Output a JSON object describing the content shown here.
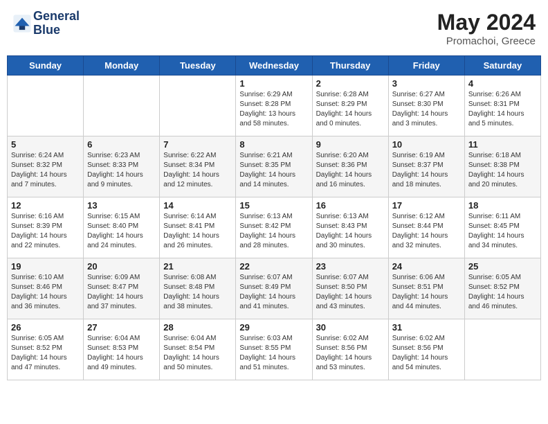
{
  "header": {
    "logo_line1": "General",
    "logo_line2": "Blue",
    "month_year": "May 2024",
    "location": "Promachoi, Greece"
  },
  "weekdays": [
    "Sunday",
    "Monday",
    "Tuesday",
    "Wednesday",
    "Thursday",
    "Friday",
    "Saturday"
  ],
  "weeks": [
    [
      {
        "day": "",
        "info": ""
      },
      {
        "day": "",
        "info": ""
      },
      {
        "day": "",
        "info": ""
      },
      {
        "day": "1",
        "info": "Sunrise: 6:29 AM\nSunset: 8:28 PM\nDaylight: 13 hours\nand 58 minutes."
      },
      {
        "day": "2",
        "info": "Sunrise: 6:28 AM\nSunset: 8:29 PM\nDaylight: 14 hours\nand 0 minutes."
      },
      {
        "day": "3",
        "info": "Sunrise: 6:27 AM\nSunset: 8:30 PM\nDaylight: 14 hours\nand 3 minutes."
      },
      {
        "day": "4",
        "info": "Sunrise: 6:26 AM\nSunset: 8:31 PM\nDaylight: 14 hours\nand 5 minutes."
      }
    ],
    [
      {
        "day": "5",
        "info": "Sunrise: 6:24 AM\nSunset: 8:32 PM\nDaylight: 14 hours\nand 7 minutes."
      },
      {
        "day": "6",
        "info": "Sunrise: 6:23 AM\nSunset: 8:33 PM\nDaylight: 14 hours\nand 9 minutes."
      },
      {
        "day": "7",
        "info": "Sunrise: 6:22 AM\nSunset: 8:34 PM\nDaylight: 14 hours\nand 12 minutes."
      },
      {
        "day": "8",
        "info": "Sunrise: 6:21 AM\nSunset: 8:35 PM\nDaylight: 14 hours\nand 14 minutes."
      },
      {
        "day": "9",
        "info": "Sunrise: 6:20 AM\nSunset: 8:36 PM\nDaylight: 14 hours\nand 16 minutes."
      },
      {
        "day": "10",
        "info": "Sunrise: 6:19 AM\nSunset: 8:37 PM\nDaylight: 14 hours\nand 18 minutes."
      },
      {
        "day": "11",
        "info": "Sunrise: 6:18 AM\nSunset: 8:38 PM\nDaylight: 14 hours\nand 20 minutes."
      }
    ],
    [
      {
        "day": "12",
        "info": "Sunrise: 6:16 AM\nSunset: 8:39 PM\nDaylight: 14 hours\nand 22 minutes."
      },
      {
        "day": "13",
        "info": "Sunrise: 6:15 AM\nSunset: 8:40 PM\nDaylight: 14 hours\nand 24 minutes."
      },
      {
        "day": "14",
        "info": "Sunrise: 6:14 AM\nSunset: 8:41 PM\nDaylight: 14 hours\nand 26 minutes."
      },
      {
        "day": "15",
        "info": "Sunrise: 6:13 AM\nSunset: 8:42 PM\nDaylight: 14 hours\nand 28 minutes."
      },
      {
        "day": "16",
        "info": "Sunrise: 6:13 AM\nSunset: 8:43 PM\nDaylight: 14 hours\nand 30 minutes."
      },
      {
        "day": "17",
        "info": "Sunrise: 6:12 AM\nSunset: 8:44 PM\nDaylight: 14 hours\nand 32 minutes."
      },
      {
        "day": "18",
        "info": "Sunrise: 6:11 AM\nSunset: 8:45 PM\nDaylight: 14 hours\nand 34 minutes."
      }
    ],
    [
      {
        "day": "19",
        "info": "Sunrise: 6:10 AM\nSunset: 8:46 PM\nDaylight: 14 hours\nand 36 minutes."
      },
      {
        "day": "20",
        "info": "Sunrise: 6:09 AM\nSunset: 8:47 PM\nDaylight: 14 hours\nand 37 minutes."
      },
      {
        "day": "21",
        "info": "Sunrise: 6:08 AM\nSunset: 8:48 PM\nDaylight: 14 hours\nand 38 minutes."
      },
      {
        "day": "22",
        "info": "Sunrise: 6:07 AM\nSunset: 8:49 PM\nDaylight: 14 hours\nand 41 minutes."
      },
      {
        "day": "23",
        "info": "Sunrise: 6:07 AM\nSunset: 8:50 PM\nDaylight: 14 hours\nand 43 minutes."
      },
      {
        "day": "24",
        "info": "Sunrise: 6:06 AM\nSunset: 8:51 PM\nDaylight: 14 hours\nand 44 minutes."
      },
      {
        "day": "25",
        "info": "Sunrise: 6:05 AM\nSunset: 8:52 PM\nDaylight: 14 hours\nand 46 minutes."
      }
    ],
    [
      {
        "day": "26",
        "info": "Sunrise: 6:05 AM\nSunset: 8:52 PM\nDaylight: 14 hours\nand 47 minutes."
      },
      {
        "day": "27",
        "info": "Sunrise: 6:04 AM\nSunset: 8:53 PM\nDaylight: 14 hours\nand 49 minutes."
      },
      {
        "day": "28",
        "info": "Sunrise: 6:04 AM\nSunset: 8:54 PM\nDaylight: 14 hours\nand 50 minutes."
      },
      {
        "day": "29",
        "info": "Sunrise: 6:03 AM\nSunset: 8:55 PM\nDaylight: 14 hours\nand 51 minutes."
      },
      {
        "day": "30",
        "info": "Sunrise: 6:02 AM\nSunset: 8:56 PM\nDaylight: 14 hours\nand 53 minutes."
      },
      {
        "day": "31",
        "info": "Sunrise: 6:02 AM\nSunset: 8:56 PM\nDaylight: 14 hours\nand 54 minutes."
      },
      {
        "day": "",
        "info": ""
      }
    ]
  ]
}
